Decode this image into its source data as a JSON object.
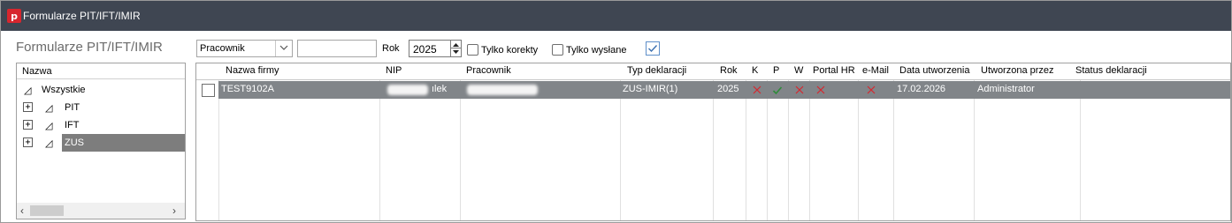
{
  "window": {
    "title": "Formularze PIT/IFT/IMIR",
    "app_icon_letter": "p",
    "accent_color": "#d7262e"
  },
  "section_title": "Formularze PIT/IFT/IMIR",
  "filters": {
    "type_combo_value": "Pracownik",
    "search_value": "",
    "year_label": "Rok",
    "year_value": "2025",
    "only_corrections_label": "Tylko korekty",
    "only_corrections_checked": false,
    "only_sent_label": "Tylko wysłane",
    "only_sent_checked": false,
    "extra_checked": true
  },
  "tree": {
    "header": "Nazwa",
    "items": [
      {
        "label": "Wszystkie",
        "expandable": false,
        "selected": false
      },
      {
        "label": "PIT",
        "expandable": true,
        "selected": false
      },
      {
        "label": "IFT",
        "expandable": true,
        "selected": false
      },
      {
        "label": "ZUS",
        "expandable": true,
        "selected": true
      }
    ]
  },
  "grid": {
    "columns": [
      "Nazwa firmy",
      "NIP",
      "Pracownik",
      "Typ deklaracji",
      "Rok",
      "K",
      "P",
      "W",
      "Portal HR",
      "e-Mail",
      "Data utworzenia",
      "Utworzona przez",
      "Status deklaracji"
    ],
    "rows": [
      {
        "company": "TEST9102A",
        "nip_fragment": "ılek",
        "declaration_type": "ZUS-IMIR(1)",
        "year": "2025",
        "k": "x",
        "p": "ok",
        "w": "x",
        "portal_hr": "x",
        "email": "x",
        "created": "17.02.2026",
        "created_by": "Administrator",
        "status": ""
      }
    ]
  },
  "colors": {
    "titlebar": "#3f4652",
    "selected_row": "#818589",
    "tree_selection": "#7d7d7d",
    "x_mark": "#d7262e",
    "ok_mark": "#2e8b3a"
  },
  "icons": [
    "app-logo-icon",
    "chevron-down-icon",
    "spin-up-icon",
    "spin-down-icon",
    "expand-icon",
    "collapse-triangle-icon",
    "scroll-left-icon",
    "scroll-right-icon",
    "x-mark-icon",
    "check-mark-icon"
  ]
}
